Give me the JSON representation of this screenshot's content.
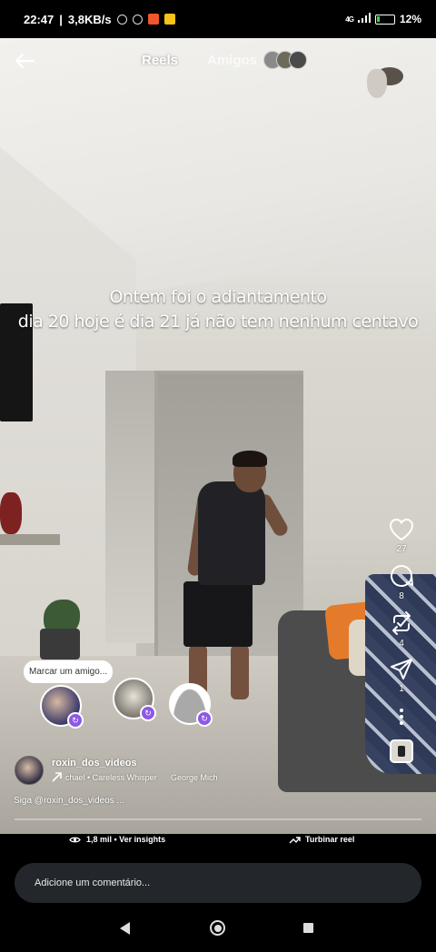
{
  "status_bar": {
    "time": "22:47",
    "network_speed": "3,8KB/s",
    "network_type": "4G",
    "battery_percent": "12",
    "battery_suffix": "%",
    "icons": [
      "mute-icon",
      "alarm-icon",
      "app-notification-icon",
      "app-notification-icon"
    ]
  },
  "header": {
    "back_icon": "arrow-left-icon",
    "tab_reels": "Reels",
    "tab_friends": "Amigos"
  },
  "caption": {
    "line1": "Ontem foi o adiantamento",
    "line2": "dia 20 hoje é dia 21 já não tem nenhum centavo"
  },
  "actions": {
    "like_count": "27",
    "comment_count": "8",
    "repost_count": "4",
    "share_count": "1",
    "icons": [
      "heart-icon",
      "comment-icon",
      "repost-icon",
      "send-icon",
      "more-icon"
    ]
  },
  "tagging": {
    "prompt": "Marcar um amigo..."
  },
  "author": {
    "username": "roxin_dos_videos",
    "music_song": "chael • Careless Whisper",
    "music_artist": "George Mich",
    "follow_text": "Siga @roxin_dos_videos ..."
  },
  "playback": {
    "progress": 0.0
  },
  "insights": {
    "views": "1,8 mil • Ver insights",
    "boost": "Turbinar reel"
  },
  "comment": {
    "placeholder": "Adicione um comentário..."
  },
  "colors": {
    "accent_purple": "#8d58e6",
    "background": "#000000",
    "comment_box": "#23272c"
  }
}
